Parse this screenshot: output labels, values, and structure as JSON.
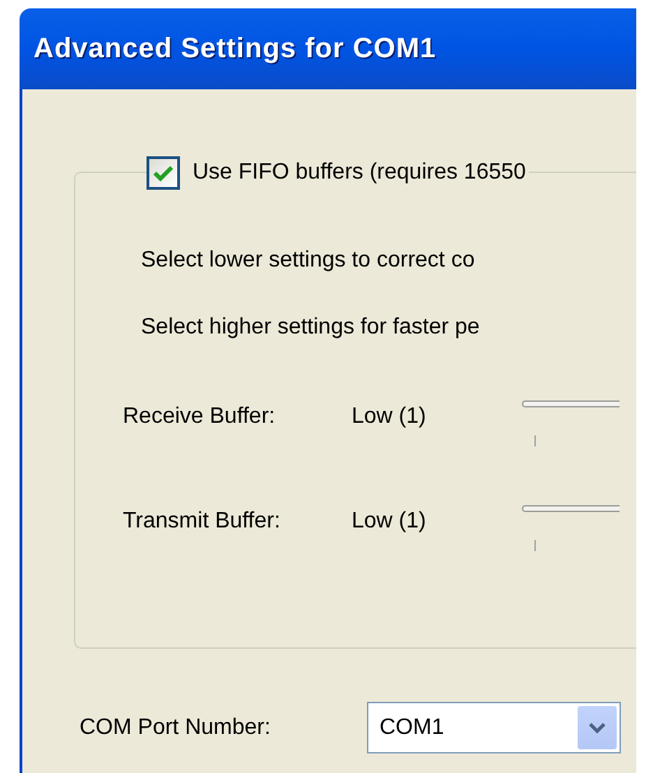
{
  "window": {
    "title": "Advanced Settings for COM1"
  },
  "fifo": {
    "label": "Use FIFO buffers (requires 16550",
    "checked": true
  },
  "notes": [
    "Select lower settings to correct co",
    "Select higher settings for faster pe"
  ],
  "buffers": [
    {
      "label": "Receive Buffer:",
      "reading": "Low (1)"
    },
    {
      "label": "Transmit Buffer:",
      "reading": "Low (1)"
    }
  ],
  "com_port": {
    "label": "COM Port Number:",
    "value": "COM1"
  }
}
